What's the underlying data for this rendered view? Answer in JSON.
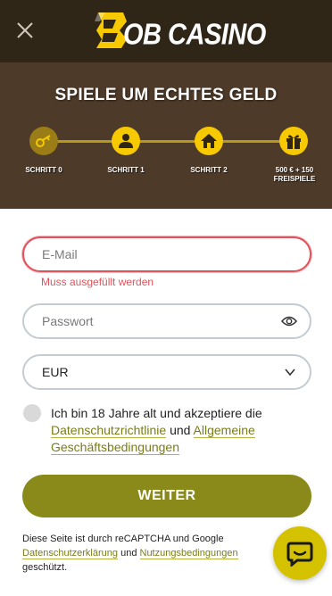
{
  "header": {
    "logo_text": "OB CASINO",
    "logo_letter": "B"
  },
  "hero": {
    "title": "SPIELE UM ECHTES GELD",
    "steps": [
      {
        "label": "SCHRITT 0",
        "icon": "key-icon",
        "state": "current"
      },
      {
        "label": "SCHRITT 1",
        "icon": "user-icon",
        "state": "pending"
      },
      {
        "label": "SCHRITT 2",
        "icon": "home-icon",
        "state": "pending"
      },
      {
        "label": "500 € + 150 FREISPIELE",
        "icon": "gift-icon",
        "state": "pending"
      }
    ]
  },
  "form": {
    "email_placeholder": "E-Mail",
    "email_error": "Muss ausgefüllt werden",
    "password_placeholder": "Passwort",
    "currency_value": "EUR",
    "terms_text_1": "Ich bin 18 Jahre alt und akzeptiere die",
    "terms_link_1": "Datenschutzrichtlinie",
    "terms_and": "und",
    "terms_link_2": "Allgemeine Geschäftsbedingungen",
    "submit_label": "WEITER"
  },
  "recaptcha": {
    "text_1": "Diese Seite ist durch reCAPTCHA und Google",
    "link_privacy": "Datenschutzerklärung",
    "and": "und",
    "link_terms": "Nutzungsbedingungen",
    "text_2": "geschützt."
  },
  "colors": {
    "header_bg": "#302617",
    "hero_bg": "#4e3a28",
    "step_active": "#f6c900",
    "accent_olive": "#8a8a1a",
    "error": "#e0535b"
  }
}
